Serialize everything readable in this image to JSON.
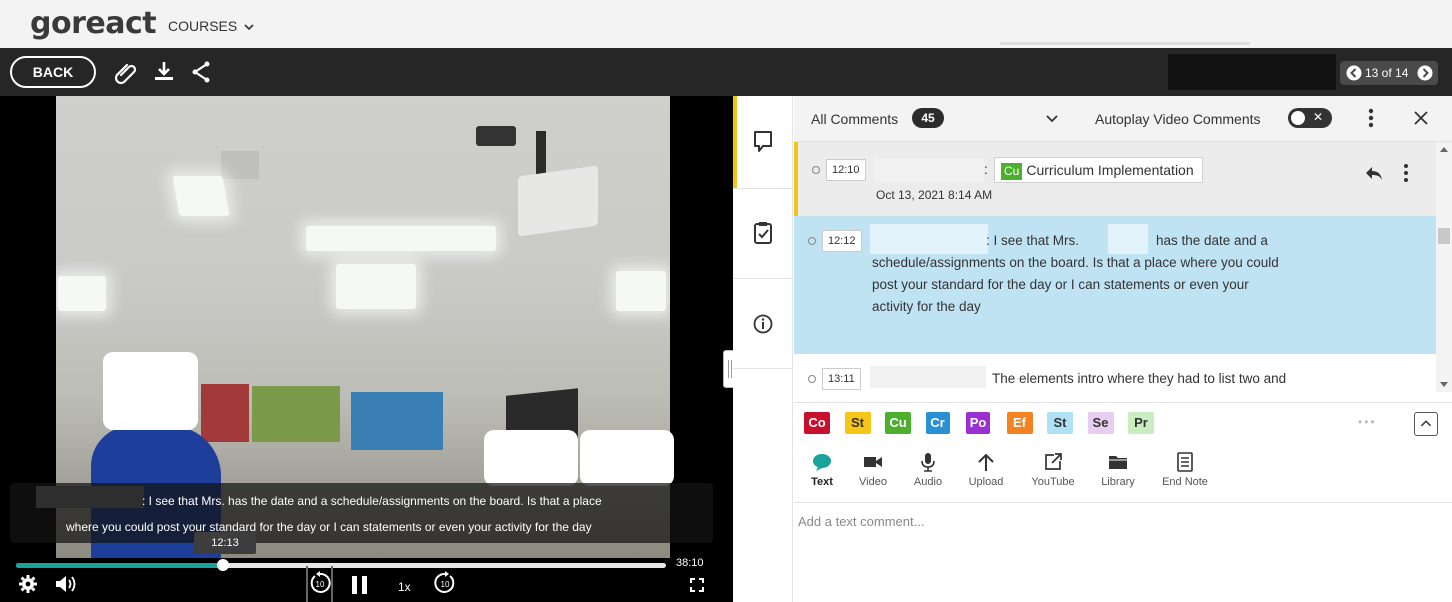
{
  "app": {
    "logo": "goreact",
    "courses_menu": "COURSES"
  },
  "toolbar": {
    "back_label": "BACK",
    "pager_text": "13 of 14"
  },
  "video": {
    "caption_line1": ": I see that Mrs.        has the date and a schedule/assignments on the board. Is that a place",
    "caption_line2": "where you could post your standard for the day or I can statements or even your activity for the day",
    "hover_time": "12:13",
    "duration": "38:10",
    "progress_fraction": 0.318,
    "speed": "1x",
    "skip_back_seconds": "10",
    "skip_forward_seconds": "10"
  },
  "panel": {
    "filter_label": "All Comments",
    "comment_count": "45",
    "autoplay_label": "Autoplay Video Comments",
    "comments": [
      {
        "timestamp": "12:10",
        "separator": ":",
        "tag_code": "Cu",
        "tag_name": "Curriculum Implementation",
        "date": "Oct 13, 2021 8:14 AM"
      },
      {
        "timestamp": "12:12",
        "text_a": ":  I see that Mrs.",
        "text_b": "has the date and a",
        "line2": "schedule/assignments on the board. Is that a place where you could",
        "line3": "post your standard for the day or I can statements or even your",
        "line4": "activity for the day"
      },
      {
        "timestamp": "13:11",
        "text": "The elements intro where they had to list two and"
      }
    ]
  },
  "tags": [
    {
      "code": "Co",
      "bg": "#c8102e",
      "fg": "#ffffff"
    },
    {
      "code": "St",
      "bg": "#f5c518",
      "fg": "#333333"
    },
    {
      "code": "Cu",
      "bg": "#4caf2d",
      "fg": "#ffffff"
    },
    {
      "code": "Cr",
      "bg": "#2b8fd6",
      "fg": "#ffffff"
    },
    {
      "code": "Po",
      "bg": "#9b2fd1",
      "fg": "#ffffff"
    },
    {
      "code": "Ef",
      "bg": "#f58220",
      "fg": "#ffffff"
    },
    {
      "code": "St",
      "bg": "#aee1f5",
      "fg": "#333333"
    },
    {
      "code": "Se",
      "bg": "#e7cdf0",
      "fg": "#333333"
    },
    {
      "code": "Pr",
      "bg": "#c9ecc0",
      "fg": "#333333"
    }
  ],
  "tags_more": "•••",
  "media_types": [
    {
      "label": "Text",
      "icon": "chat-bubble-icon"
    },
    {
      "label": "Video",
      "icon": "video-camera-icon"
    },
    {
      "label": "Audio",
      "icon": "microphone-icon"
    },
    {
      "label": "Upload",
      "icon": "upload-arrow-icon"
    },
    {
      "label": "YouTube",
      "icon": "external-link-icon"
    },
    {
      "label": "Library",
      "icon": "folder-icon"
    },
    {
      "label": "End Note",
      "icon": "document-icon"
    }
  ],
  "composer": {
    "placeholder": "Add a text comment..."
  },
  "colors": {
    "accent_yellow": "#f0c419",
    "teal": "#1aa39a",
    "active_comment": "#bfe3f3"
  }
}
